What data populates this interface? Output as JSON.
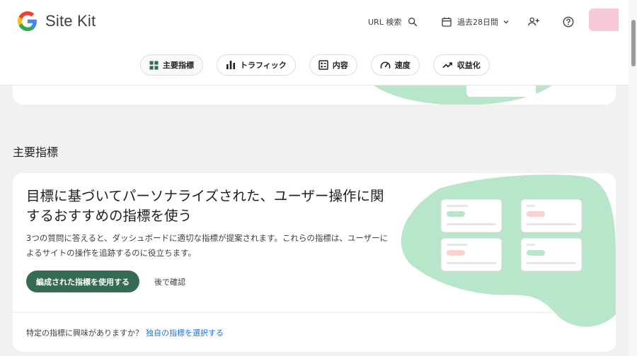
{
  "header": {
    "logo_text": "Site Kit",
    "url_search_label": "URL 検索",
    "date_range_label": "過去28日間",
    "icons": [
      "google-g-icon",
      "search-icon",
      "calendar-icon",
      "chevron-down-icon",
      "user-add-icon",
      "help-icon"
    ]
  },
  "tabs": [
    {
      "label": "主要指標",
      "icon": "grid-icon"
    },
    {
      "label": "トラフィック",
      "icon": "bar-chart-icon"
    },
    {
      "label": "内容",
      "icon": "content-icon"
    },
    {
      "label": "速度",
      "icon": "speedometer-icon"
    },
    {
      "label": "収益化",
      "icon": "trending-up-icon"
    }
  ],
  "section": {
    "title": "主要指標"
  },
  "card": {
    "title": "目標に基づいてパーソナライズされた、ユーザー操作に関するおすすめの指標を使う",
    "description": "3つの質問に答えると、ダッシュボードに適切な指標が提案されます。これらの指標は、ユーザーによるサイトの操作を追跡するのに役立ちます。",
    "primary_button": "編成された指標を使用する",
    "secondary_button": "後で確認",
    "footer_text": "特定の指標に興味がありますか？",
    "footer_link": "独自の指標を選択する"
  },
  "colors": {
    "primary": "#356b52",
    "illustration_green": "#b8e6ca",
    "link": "#1a73e8"
  }
}
